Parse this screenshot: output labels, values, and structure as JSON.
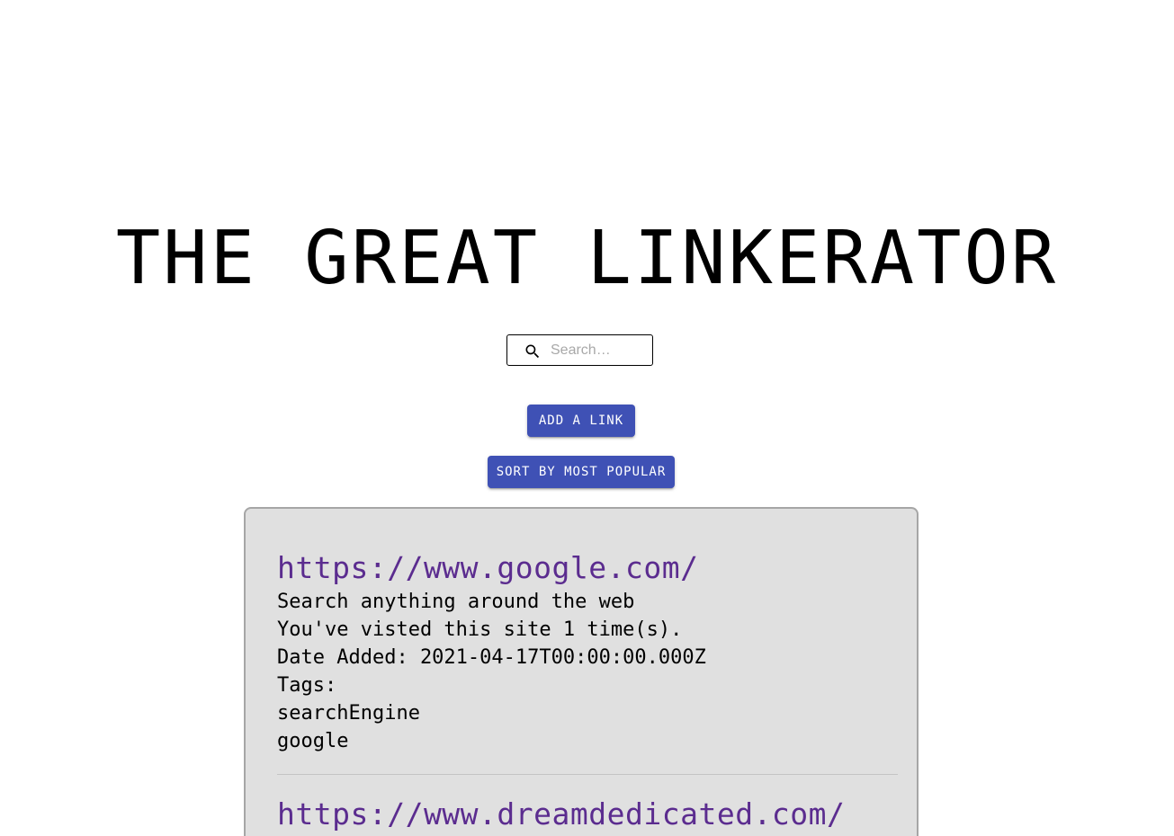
{
  "header": {
    "title": "THE GREAT LINKERATOR"
  },
  "search": {
    "placeholder": "Search…",
    "value": "",
    "icon": "search-icon"
  },
  "actions": {
    "add_label": "Add a link",
    "sort_label": "Sort by most popular"
  },
  "colors": {
    "button": "#3f51b5",
    "link": "#5b2c8f",
    "card_background": "#e0e0e0"
  },
  "links": [
    {
      "url": "https://www.google.com/",
      "description": "Search anything around the web",
      "visits_text": "You've visted this site 1 time(s).",
      "date_text": "Date Added: 2021-04-17T00:00:00.000Z",
      "tags_label": "Tags:",
      "tags": [
        "searchEngine",
        "google"
      ]
    },
    {
      "url": "https://www.dreamdedicated.com/"
    }
  ]
}
